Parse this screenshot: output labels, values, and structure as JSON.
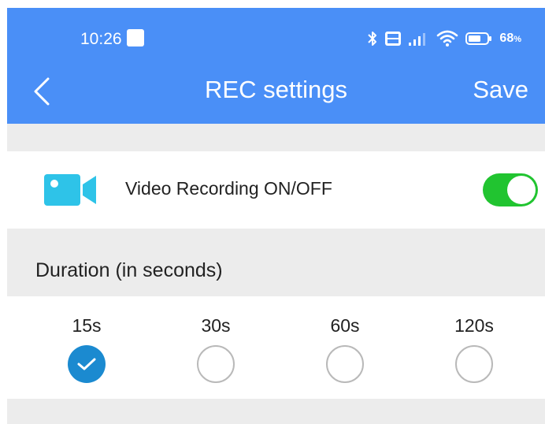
{
  "status_bar": {
    "time": "10:26",
    "battery_percent": "68",
    "battery_unit": "%",
    "icons": [
      "app-notification-icon",
      "bluetooth-icon",
      "volte-icon",
      "signal-icon",
      "wifi-icon",
      "battery-icon"
    ]
  },
  "header": {
    "title": "REC settings",
    "save_label": "Save",
    "background_color": "#4a8ff7"
  },
  "video_recording": {
    "label": "Video Recording ON/OFF",
    "enabled": true,
    "icon": "video-camera-icon",
    "toggle_on_color": "#21c430"
  },
  "duration": {
    "heading": "Duration (in seconds)",
    "options": [
      {
        "label": "15s",
        "selected": true
      },
      {
        "label": "30s",
        "selected": false
      },
      {
        "label": "60s",
        "selected": false
      },
      {
        "label": "120s",
        "selected": false
      }
    ],
    "selected_color": "#1b8ad0"
  }
}
